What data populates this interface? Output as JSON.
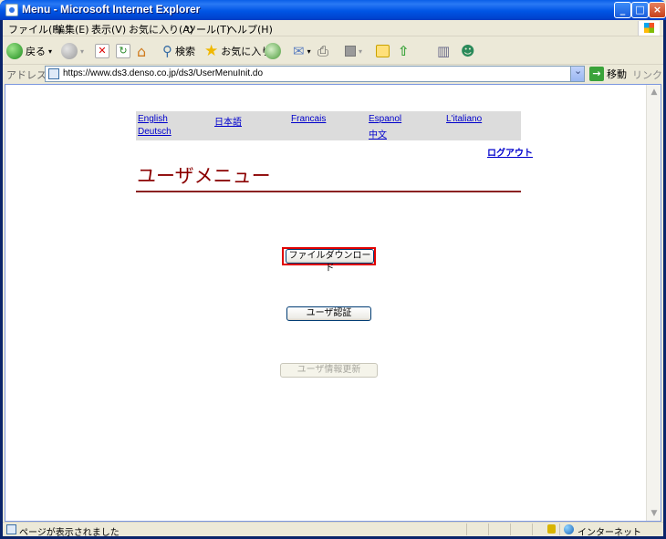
{
  "window": {
    "title": "Menu - Microsoft Internet Explorer",
    "controls": {
      "minimize": "_",
      "maximize": "□",
      "close": "×"
    }
  },
  "menubar": [
    "ファイル(F)",
    "編集(E)",
    "表示(V)",
    "お気に入り(A)",
    "ツール(T)",
    "ヘルプ(H)"
  ],
  "toolbar": {
    "back_label": "戻る",
    "search_label": "検索",
    "favorites_label": "お気に入り"
  },
  "addressbar": {
    "label": "アドレス(D)",
    "url": "https://www.ds3.denso.co.jp/ds3/UserMenuInit.do",
    "go_label": "移動",
    "links_label": "リンク »"
  },
  "page": {
    "languages": [
      "English",
      "日本語",
      "Francais",
      "Espanol",
      "L'italiano",
      "Deutsch",
      "中文"
    ],
    "logout_label": "ログアウト",
    "heading": "ユーザメニュー",
    "download_button": "ファイルダウンロード",
    "auth_button": "ユーザ認証",
    "update_button": "ユーザ情報更新"
  },
  "statusbar": {
    "text": "ページが表示されました",
    "zone": "インターネット"
  },
  "colors": {
    "heading": "#8b0000",
    "highlight_border": "#e00000",
    "link": "#0000cc",
    "language_bar": "#dcdcdc"
  }
}
